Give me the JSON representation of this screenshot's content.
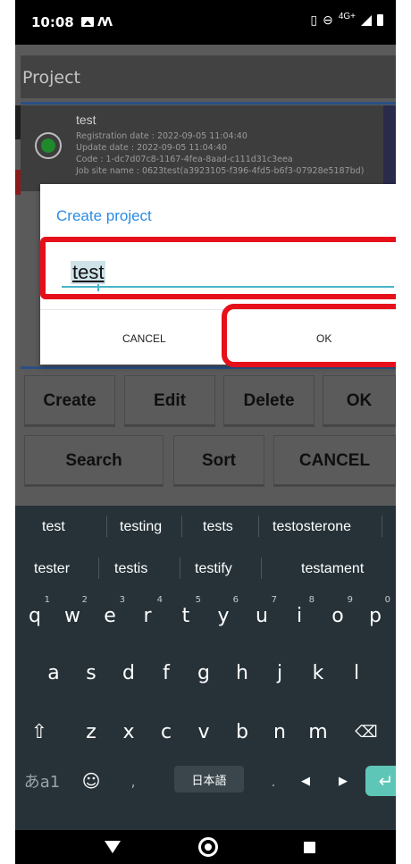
{
  "status_bar": {
    "time": "10:08",
    "network": "4G+"
  },
  "app": {
    "title": "Project",
    "project_item": {
      "name": "test",
      "registration_date": "Registration date : 2022-09-05 11:04:40",
      "update_date": "Update date : 2022-09-05 11:04:40",
      "code": "Code : 1-dc7d07c8-1167-4fea-8aad-c111d31c3eea",
      "job_site_name": "Job site name : 0623test(a3923105-f396-4fd5-b6f3-07928e5187bd)"
    },
    "buttons": {
      "create": "Create",
      "edit": "Edit",
      "delete": "Delete",
      "ok": "OK",
      "search": "Search",
      "sort": "Sort",
      "cancel": "CANCEL"
    }
  },
  "dialog": {
    "title": "Create project",
    "input_value": "test",
    "cancel_label": "CANCEL",
    "ok_label": "OK"
  },
  "keyboard": {
    "suggestions_row1": [
      "test",
      "testing",
      "tests",
      "testosterone"
    ],
    "suggestions_row2": [
      "tester",
      "testis",
      "testify",
      "testament"
    ],
    "row1": [
      "q",
      "w",
      "e",
      "r",
      "t",
      "y",
      "u",
      "i",
      "o",
      "p"
    ],
    "row1_hints": [
      "1",
      "2",
      "3",
      "4",
      "5",
      "6",
      "7",
      "8",
      "9",
      "0"
    ],
    "row2": [
      "a",
      "s",
      "d",
      "f",
      "g",
      "h",
      "j",
      "k",
      "l"
    ],
    "row3": [
      "z",
      "x",
      "c",
      "v",
      "b",
      "n",
      "m"
    ],
    "lang_key": "あa1",
    "comma": ",",
    "space_label": "日本語",
    "period": "."
  },
  "colors": {
    "accent_blue": "#2c8be3",
    "highlight_red": "#e5101a",
    "keyboard_bg": "#263238",
    "enter_key": "#5ec6b7"
  }
}
